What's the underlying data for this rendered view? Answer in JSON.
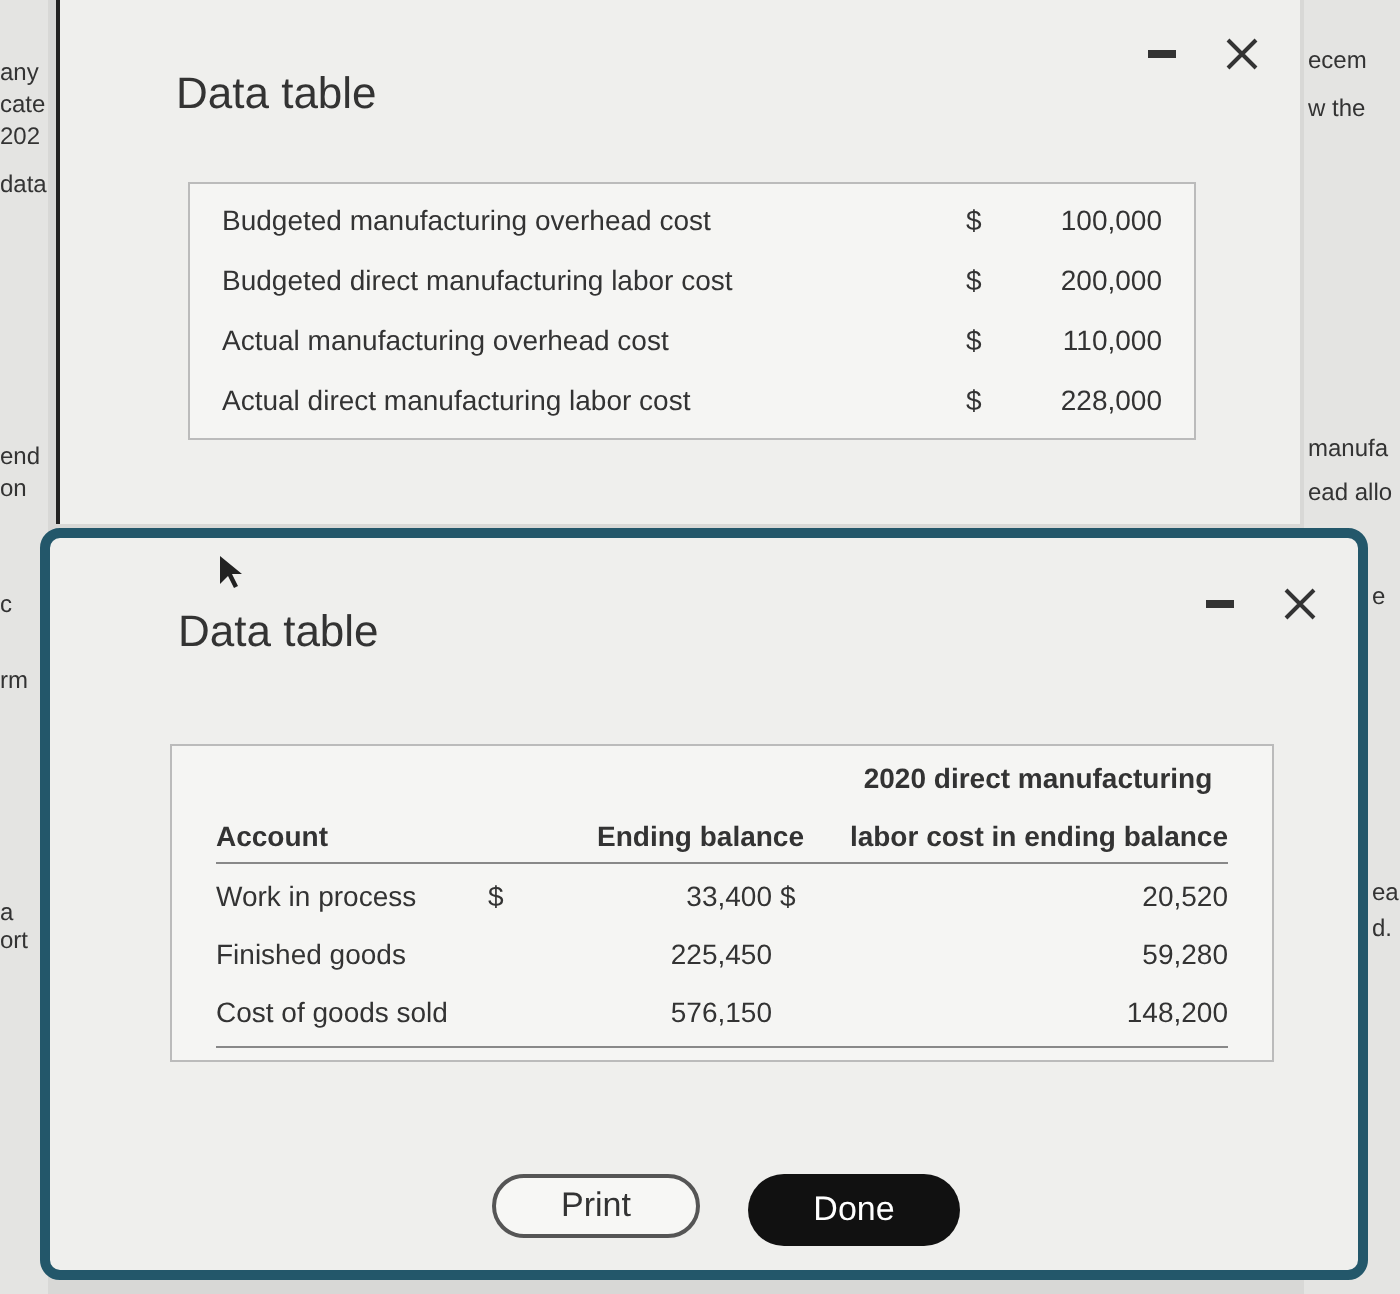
{
  "background": {
    "left_fragments": [
      "any",
      "cate",
      "202",
      "data",
      "end",
      "on",
      "c",
      "rm",
      "a",
      "ort"
    ],
    "right_fragments": [
      "ecem",
      "w the",
      "manufa",
      "ead allo",
      "e",
      "ea",
      "d."
    ]
  },
  "back_window": {
    "title": "Data table",
    "rows": [
      {
        "label": "Budgeted manufacturing overhead cost",
        "currency": "$",
        "amount": "100,000"
      },
      {
        "label": "Budgeted direct manufacturing labor cost",
        "currency": "$",
        "amount": "200,000"
      },
      {
        "label": "Actual manufacturing overhead cost",
        "currency": "$",
        "amount": "110,000"
      },
      {
        "label": "Actual direct manufacturing labor cost",
        "currency": "$",
        "amount": "228,000"
      }
    ]
  },
  "front_window": {
    "title": "Data table",
    "columns": [
      "Account",
      "Ending balance",
      "2020 direct manufacturing",
      "labor cost in ending balance"
    ],
    "rows": [
      {
        "account": "Work in process",
        "currency": "$",
        "ending_balance": "33,400",
        "labor_currency": "$",
        "labor_cost": "20,520"
      },
      {
        "account": "Finished goods",
        "ending_balance": "225,450",
        "labor_cost": "59,280"
      },
      {
        "account": "Cost of goods sold",
        "ending_balance": "576,150",
        "labor_cost": "148,200"
      }
    ],
    "buttons": [
      {
        "label": "Print",
        "kind": "secondary"
      },
      {
        "label": "Done",
        "kind": "primary"
      }
    ]
  }
}
